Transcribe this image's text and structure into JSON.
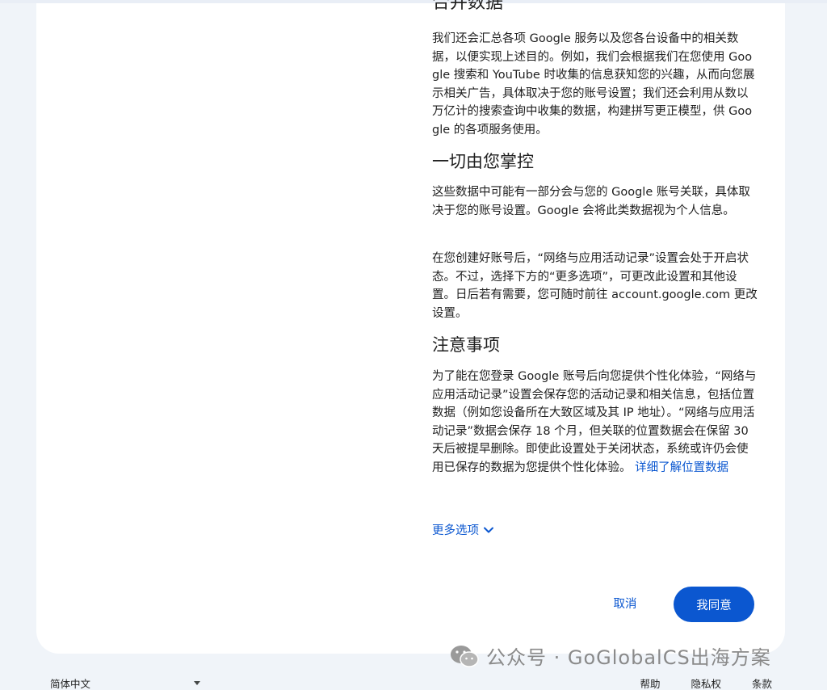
{
  "content": {
    "section_cut_title": "合并数据",
    "para1": "我们还会汇总各项 Google 服务以及您各台设备中的相关数据，以便实现上述目的。例如，我们会根据我们在您使用 Google 搜索和 YouTube 时收集的信息获知您的兴趣，从而向您展示相关广告，具体取决于您的账号设置；我们还会利用从数以万亿计的搜索查询中收集的数据，构建拼写更正模型，供 Google 的各项服务使用。",
    "heading2": "一切由您掌控",
    "para2": "这些数据中可能有一部分会与您的 Google 账号关联，具体取决于您的账号设置。Google 会将此类数据视为个人信息。",
    "para3": "在您创建好账号后，“网络与应用活动记录”设置会处于开启状态。不过，选择下方的“更多选项”，可更改此设置和其他设置。日后若有需要，您可随时前往 account.google.com 更改设置。",
    "heading3": "注意事项",
    "para4": "为了能在您登录 Google 账号后向您提供个性化体验，“网络与应用活动记录”设置会保存您的活动记录和相关信息，包括位置数据（例如您设备所在大致区域及其 IP 地址）。“网络与应用活动记录”数据会保存 18 个月，但关联的位置数据会在保留 30 天后被提早删除。即使此设置处于关闭状态，系统或许仍会使用已保存的数据为您提供个性化体验。",
    "para4_link": "详细了解位置数据",
    "more_options": "更多选项"
  },
  "actions": {
    "cancel": "取消",
    "agree": "我同意"
  },
  "footer": {
    "language": "简体中文",
    "links": [
      "帮助",
      "隐私权",
      "条款"
    ]
  },
  "watermark": {
    "text": "公众号 · GoGlobalCS出海方案"
  },
  "colors": {
    "accent": "#0b57d0",
    "background": "#f0f4f9",
    "card": "#ffffff",
    "text": "#1f1f1f"
  },
  "icons": {
    "more_options": "chevron-down-icon",
    "language": "caret-down-icon",
    "watermark": "wechat-icon"
  }
}
